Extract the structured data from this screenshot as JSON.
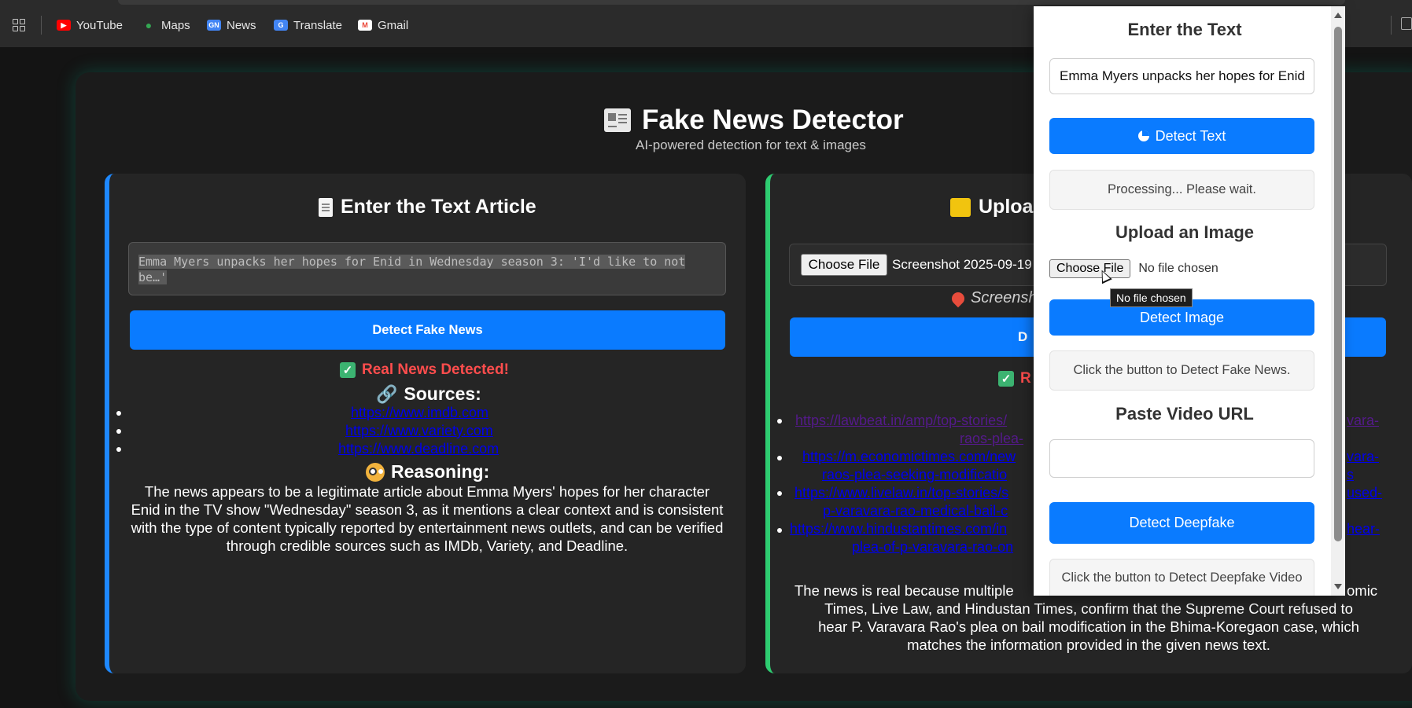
{
  "bookmarks": [
    {
      "label": "YouTube",
      "icon": "youtube-icon",
      "color": "#ff0000"
    },
    {
      "label": "Maps",
      "icon": "maps-icon",
      "color": "#34a853"
    },
    {
      "label": "News",
      "icon": "news-icon",
      "color": "#4285f4"
    },
    {
      "label": "Translate",
      "icon": "translate-icon",
      "color": "#4285f4"
    },
    {
      "label": "Gmail",
      "icon": "gmail-icon",
      "color": "#ea4335"
    }
  ],
  "header": {
    "title": "Fake News Detector",
    "subtitle": "AI-powered detection for text & images"
  },
  "left_card": {
    "title": "Enter the Text Article",
    "textarea_value": "Emma Myers unpacks her hopes for Enid in Wednesday season 3: 'I'd like to not be…'",
    "button_label": "Detect Fake News",
    "result": "Real News Detected!",
    "sources_heading": "Sources:",
    "sources": [
      "https://www.imdb.com",
      "https://www.variety.com",
      "https://www.deadline.com"
    ],
    "reasoning_heading": "Reasoning:",
    "reasoning": "The news appears to be a legitimate article about Emma Myers' hopes for her character Enid in the TV show \"Wednesday\" season 3, as it mentions a clear context and is consistent with the type of content typically reported by entertainment news outlets, and can be verified through credible sources such as IMDb, Variety, and Deadline."
  },
  "right_card": {
    "title": "Uploa",
    "choose_file_label": "Choose File",
    "file_name": "Screenshot 2025-09-19",
    "screenshot_line": "Screensh",
    "button_label": "D",
    "result": "R",
    "links_left": [
      "https://lawbeat.in/amp/top-stories/",
      "raos-plea-",
      "https://m.economictimes.com/new",
      "raos-plea-seeking-modificatio",
      "https://www.livelaw.in/top-stories/s",
      "p-varavara-rao-medical-bail-c",
      "https://www.hindustantimes.com/in",
      "plea-of-p-varavara-rao-on"
    ],
    "links_right": [
      "vara-",
      "vara-",
      "s",
      "used-",
      "hear-"
    ],
    "reasoning_lines": [
      "The news is real because multiple",
      "omic",
      "Times, Live Law, and Hindustan Times, confirm that the Supreme Court refused to",
      "hear P. Varavara Rao's plea on bail modification in the Bhima-Koregaon case, which",
      "matches the information provided in the given news text."
    ]
  },
  "popup": {
    "text_heading": "Enter the Text",
    "text_value": "Emma Myers unpacks her hopes for Enid",
    "detect_text_label": "Detect Text",
    "processing_status": "Processing... Please wait.",
    "image_heading": "Upload an Image",
    "choose_file_label": "Choose File",
    "no_file_label": "No file chosen",
    "tooltip": "No file chosen",
    "detect_image_label": "Detect Image",
    "image_status": "Click the button to Detect Fake News.",
    "video_heading": "Paste Video URL",
    "video_value": "",
    "detect_deepfake_label": "Detect Deepfake",
    "deepfake_status": "Click the button to Detect Deepfake Video"
  },
  "colors": {
    "accent_blue": "#0a7bff",
    "result_red": "#ff4d4d",
    "left_border": "#1e88ff",
    "right_border": "#2ecc71"
  }
}
